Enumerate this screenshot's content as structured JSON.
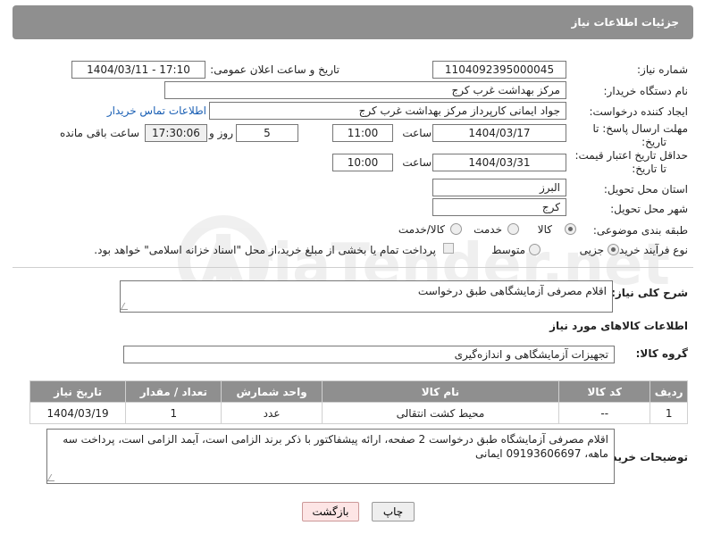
{
  "header": {
    "title": "جزئیات اطلاعات نیاز"
  },
  "form": {
    "need_number": {
      "label": "شماره نیاز:",
      "value": "1104092395000045"
    },
    "announce_datetime": {
      "label": "تاریخ و ساعت اعلان عمومی:",
      "value": "1404/03/11 - 17:10"
    },
    "buyer_org": {
      "label": "نام دستگاه خریدار:",
      "value": "مرکز بهداشت غرب کرج"
    },
    "requester": {
      "label": "ایجاد کننده درخواست:",
      "value": "جواد ایمانی کارپرداز مرکز بهداشت غرب کرج",
      "contact_link": "اطلاعات تماس خریدار"
    },
    "reply_deadline": {
      "label_line1": "مهلت ارسال پاسخ: تا",
      "label_line2": "تاریخ:",
      "date": "1404/03/17",
      "time_label": "ساعت",
      "time": "11:00",
      "days": "5",
      "days_label": "روز و",
      "remaining": "17:30:06",
      "remaining_label": "ساعت باقی مانده"
    },
    "price_validity": {
      "label_line1": "حداقل تاریخ اعتبار قیمت:",
      "label_line2": "تا تاریخ:",
      "date": "1404/03/31",
      "time_label": "ساعت",
      "time": "10:00"
    },
    "province": {
      "label": "استان محل تحویل:",
      "value": "البرز"
    },
    "city": {
      "label": "شهر محل تحویل:",
      "value": "کرج"
    },
    "category": {
      "label": "طبقه بندی موضوعی:",
      "options": [
        "کالا",
        "خدمت",
        "کالا/خدمت"
      ],
      "selected": "کالا"
    },
    "purchase_process": {
      "label": "نوع فرآیند خرید :",
      "options": [
        "جزیی",
        "متوسط"
      ],
      "selected": "جزیی",
      "payment_note": "پرداخت تمام یا بخشی از مبلغ خرید،از محل \"اسناد خزانه اسلامی\" خواهد بود."
    }
  },
  "description": {
    "label": "شرح کلی نیاز:",
    "value": "اقلام مصرفی آزمایشگاهی طبق درخواست"
  },
  "goods_section": {
    "title": "اطلاعات کالاهای مورد نیاز"
  },
  "goods_group": {
    "label": "گروه کالا:",
    "value": "تجهیزات آزمایشگاهی و اندازه‌گیری"
  },
  "table": {
    "headers": [
      "ردیف",
      "کد کالا",
      "نام کالا",
      "واحد شمارش",
      "تعداد / مقدار",
      "تاریخ نیاز"
    ],
    "rows": [
      [
        "1",
        "--",
        "محیط کشت انتقالی",
        "عدد",
        "1",
        "1404/03/19"
      ]
    ]
  },
  "buyer_notes": {
    "label": "توضیحات خریدار:",
    "value": "اقلام مصرفی آزمایشگاه طبق درخواست 2 صفحه، ارائه پیشفاکتور با ذکر برند الزامی است، آیمد الزامی است، پرداخت سه ماهه، 09193606697 ایمانی"
  },
  "buttons": {
    "print": "چاپ",
    "back": "بازگشت"
  },
  "watermark": {
    "text": "AriaTender.net"
  }
}
